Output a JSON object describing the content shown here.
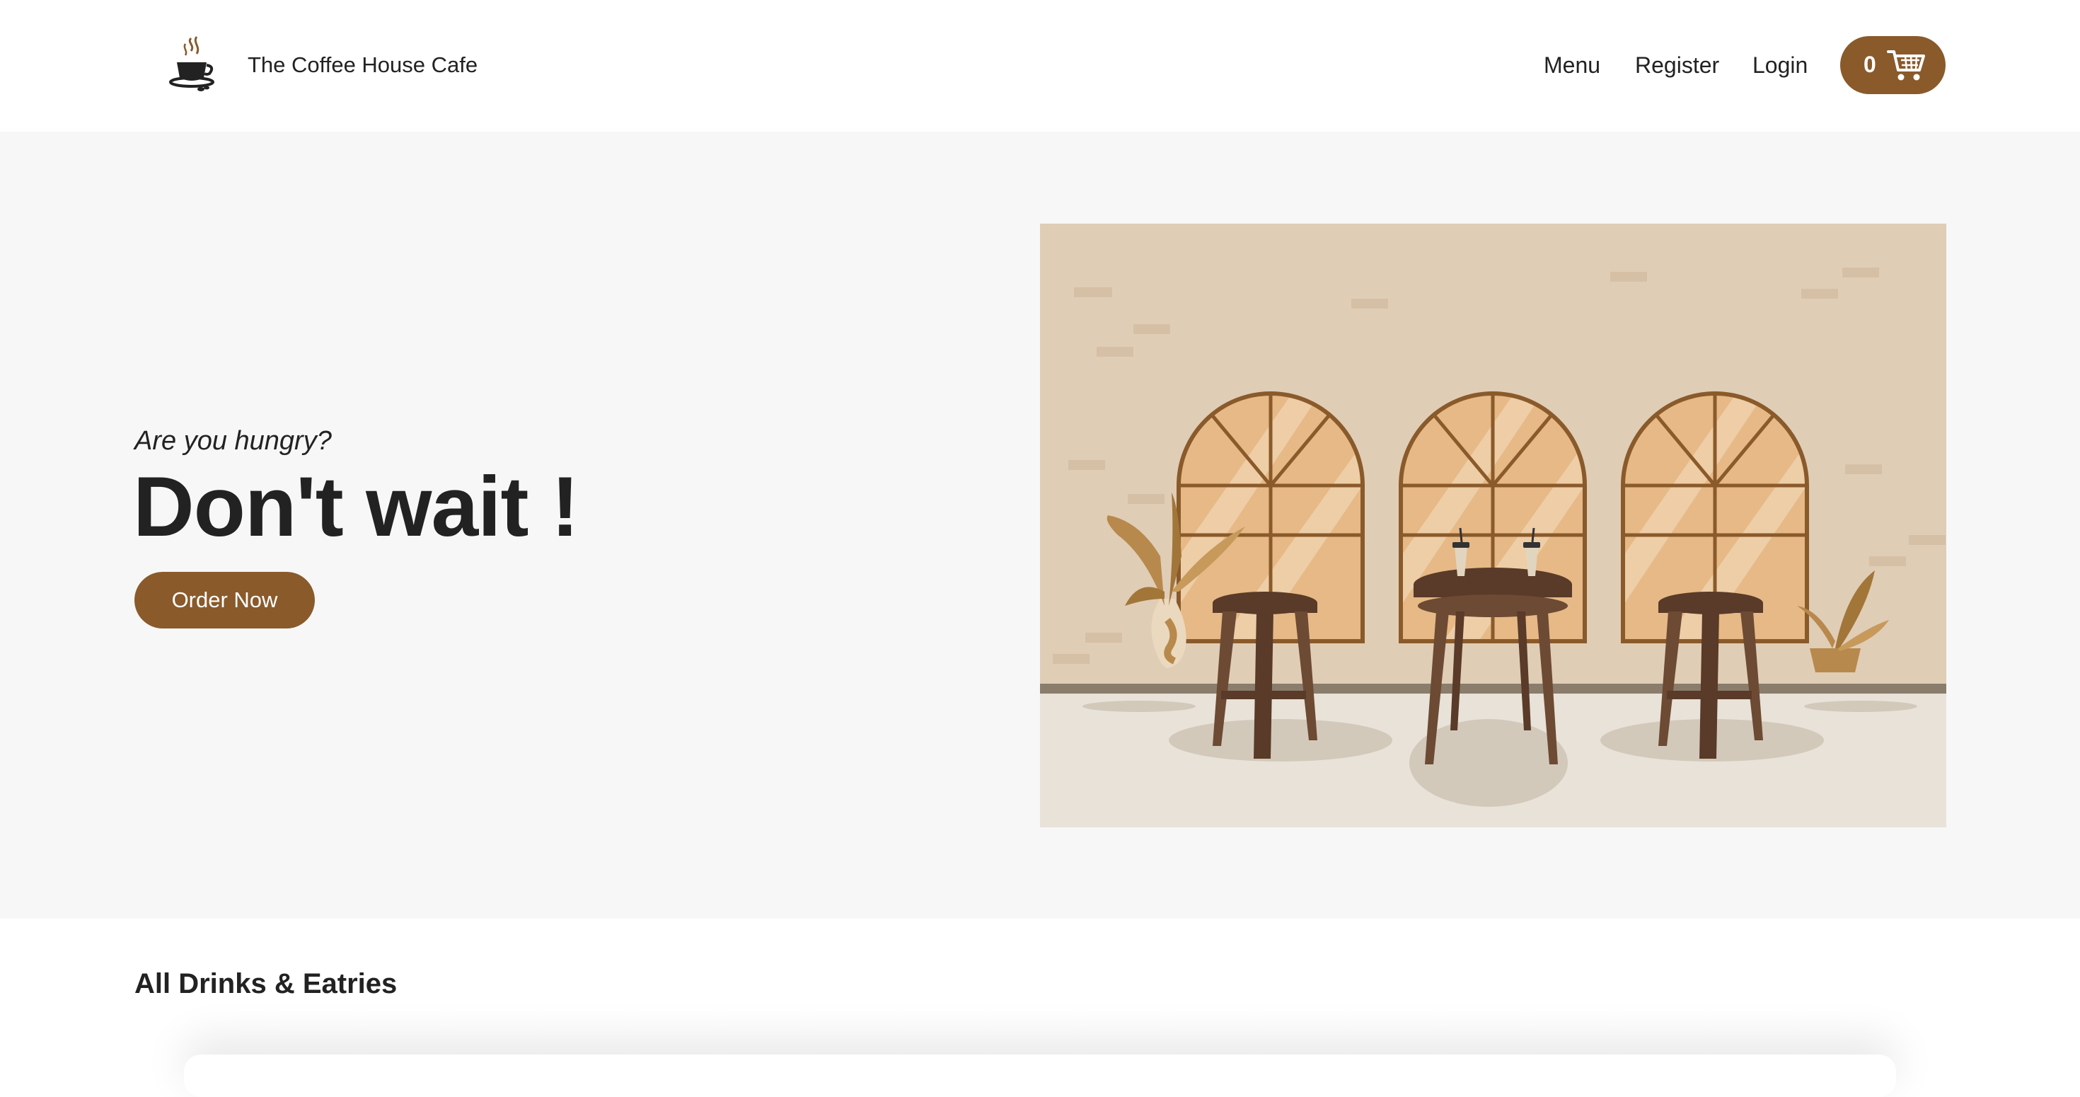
{
  "header": {
    "brand": "The Coffee House Cafe",
    "logo_icon": "coffee-cup-icon",
    "nav": {
      "menu": "Menu",
      "register": "Register",
      "login": "Login"
    },
    "cart": {
      "count": "0",
      "icon": "shopping-cart-icon"
    }
  },
  "hero": {
    "kicker": "Are you hungry?",
    "title": "Don't wait !",
    "order_button": "Order Now",
    "illustration": "cafe-interior-illustration"
  },
  "section": {
    "title": "All Drinks & Eatries"
  },
  "colors": {
    "accent": "#8a5a2b",
    "hero_bg": "#f7f7f7",
    "text": "#222222"
  }
}
